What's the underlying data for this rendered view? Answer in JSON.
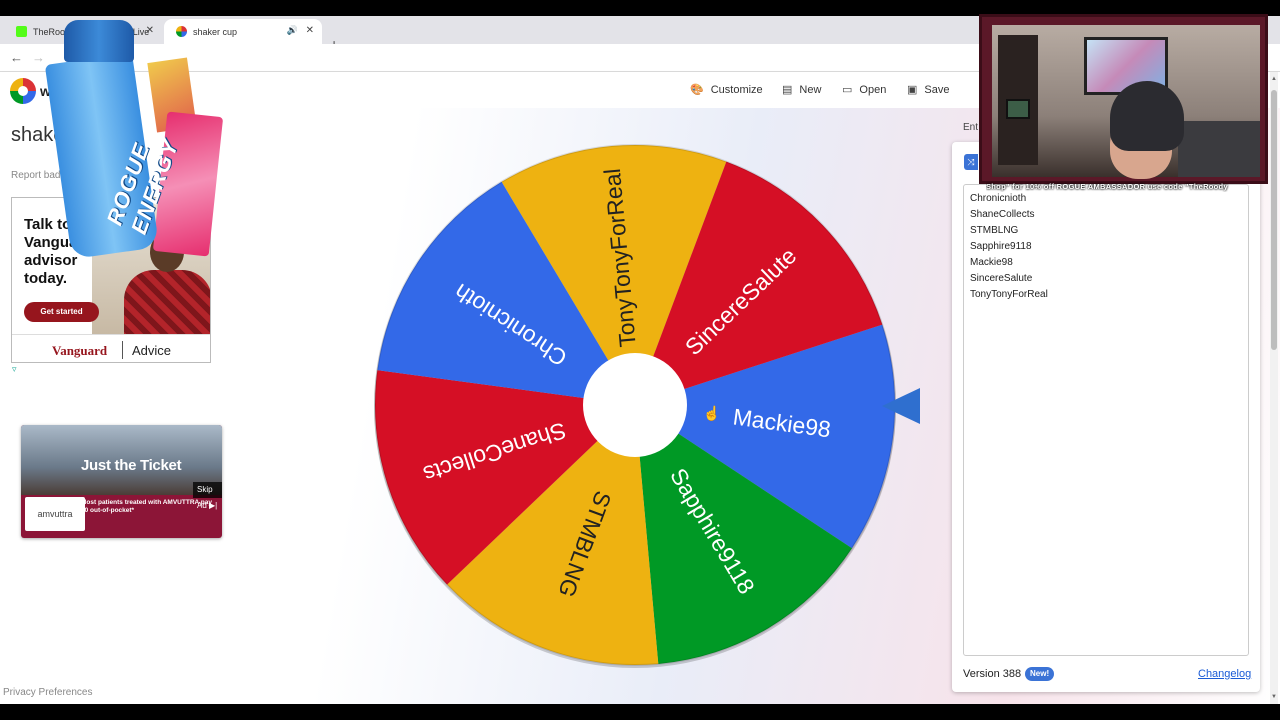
{
  "browser": {
    "tabs": [
      {
        "label": "TheRoodyShow - Watch Live",
        "active": false
      },
      {
        "label": "shaker cup",
        "active": true
      }
    ],
    "new_tab": "+",
    "back": "←",
    "forward": "→"
  },
  "header": {
    "brand": "w",
    "menu": [
      {
        "label": "Customize",
        "icon": "palette-icon"
      },
      {
        "label": "New",
        "icon": "file-icon"
      },
      {
        "label": "Open",
        "icon": "folder-icon"
      },
      {
        "label": "Save",
        "icon": "save-icon"
      }
    ]
  },
  "page": {
    "title": "shake",
    "report": "Report bad a",
    "privacy": "Privacy Preferences"
  },
  "ads": {
    "vanguard": {
      "headline": "Talk to a Vanguard advisor today.",
      "cta": "Get started",
      "brand": "Vanguard",
      "brand_suffix": "Advice"
    },
    "amvuttra": {
      "headline": "Just the Ticket",
      "body": "Most patients treated with AMVUTTRA pay $0 out-of-pocket*",
      "logo": "amvuttra",
      "skip": "Skip Ad ▶|"
    }
  },
  "overlay": {
    "can_text": "ROGUE ENERGY",
    "banner": "Shop\" for 10% off  ROGUE  AMBASSADOR  use code \"TheRoody"
  },
  "wheel": {
    "segments": [
      {
        "label": "Mackie98",
        "color": "#3369e8"
      },
      {
        "label": "Sapphire9118",
        "color": "#009925"
      },
      {
        "label": "STMBLNG",
        "color": "#eeb211"
      },
      {
        "label": "ShaneCollects",
        "color": "#d50f25"
      },
      {
        "label": "Chronicnioth",
        "color": "#3369e8"
      },
      {
        "label": "TonyTonyForReal",
        "color": "#eeb211"
      },
      {
        "label": "SincereSalute",
        "color": "#d50f25"
      }
    ]
  },
  "panel": {
    "tab_label": "Ent",
    "entries": [
      "Chronicnioth",
      "ShaneCollects",
      "STMBLNG",
      "Sapphire9118",
      "Mackie98",
      "SincereSalute",
      "TonyTonyForReal"
    ],
    "version": "Version 388",
    "new_badge": "New!",
    "changelog": "Changelog"
  }
}
